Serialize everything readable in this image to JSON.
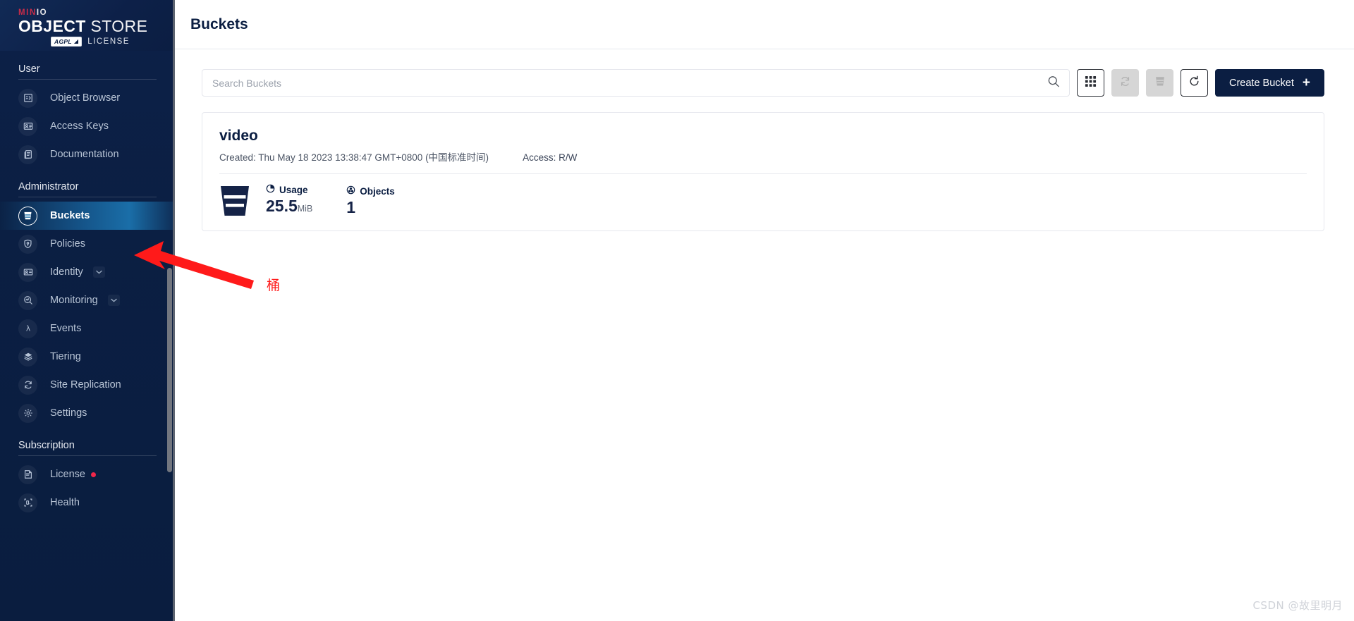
{
  "brand": {
    "minio": "MIN",
    "minio_io": "IO",
    "object": "OBJECT",
    "store": " STORE",
    "agpl_badge": "AGPL",
    "license": "LICENSE"
  },
  "sidebar": {
    "sections": [
      {
        "title": "User",
        "items": [
          {
            "label": "Object Browser",
            "icon": "object-browser-icon",
            "active": false
          },
          {
            "label": "Access Keys",
            "icon": "access-keys-icon",
            "active": false
          },
          {
            "label": "Documentation",
            "icon": "documentation-icon",
            "active": false
          }
        ]
      },
      {
        "title": "Administrator",
        "items": [
          {
            "label": "Buckets",
            "icon": "bucket-icon",
            "active": true
          },
          {
            "label": "Policies",
            "icon": "policies-icon",
            "active": false
          },
          {
            "label": "Identity",
            "icon": "identity-icon",
            "active": false,
            "chevron": true
          },
          {
            "label": "Monitoring",
            "icon": "monitoring-icon",
            "active": false,
            "chevron": true
          },
          {
            "label": "Events",
            "icon": "events-lambda-icon",
            "active": false
          },
          {
            "label": "Tiering",
            "icon": "tiering-layers-icon",
            "active": false
          },
          {
            "label": "Site Replication",
            "icon": "site-replication-icon",
            "active": false
          },
          {
            "label": "Settings",
            "icon": "settings-gear-icon",
            "active": false
          }
        ]
      },
      {
        "title": "Subscription",
        "items": [
          {
            "label": "License",
            "icon": "license-icon",
            "active": false,
            "dot": true
          },
          {
            "label": "Health",
            "icon": "health-icon",
            "active": false
          }
        ]
      }
    ]
  },
  "header": {
    "title": "Buckets"
  },
  "toolbar": {
    "search_placeholder": "Search Buckets",
    "search_value": "",
    "search_icon": "search-icon",
    "buttons": [
      {
        "name": "grid-view-button",
        "icon": "grid-icon",
        "disabled": false
      },
      {
        "name": "replication-button",
        "icon": "replication-icon",
        "disabled": true
      },
      {
        "name": "delete-buckets-button",
        "icon": "trash-bucket-icon",
        "disabled": true
      },
      {
        "name": "refresh-button",
        "icon": "refresh-icon",
        "disabled": false
      }
    ],
    "create_label": "Create Bucket",
    "create_plus": "+"
  },
  "buckets": [
    {
      "name": "video",
      "created_label": "Created: Thu May 18 2023 13:38:47 GMT+0800 (中国标准时间)",
      "access_label": "Access: R/W",
      "usage_title": "Usage",
      "usage_value": "25.5",
      "usage_unit": "MiB",
      "objects_title": "Objects",
      "objects_value": "1"
    }
  ],
  "annotation": {
    "text": "桶",
    "arrow_color": "#ff1a1a"
  },
  "watermark": {
    "text": "CSDN @故里明月"
  },
  "colors": {
    "sidebar_bg": "#0b1e42",
    "accent_red": "#c72c48",
    "active_gradient_mid": "#1a6ea8",
    "primary_button": "#0b1e42",
    "license_dot": "#f0274a"
  }
}
